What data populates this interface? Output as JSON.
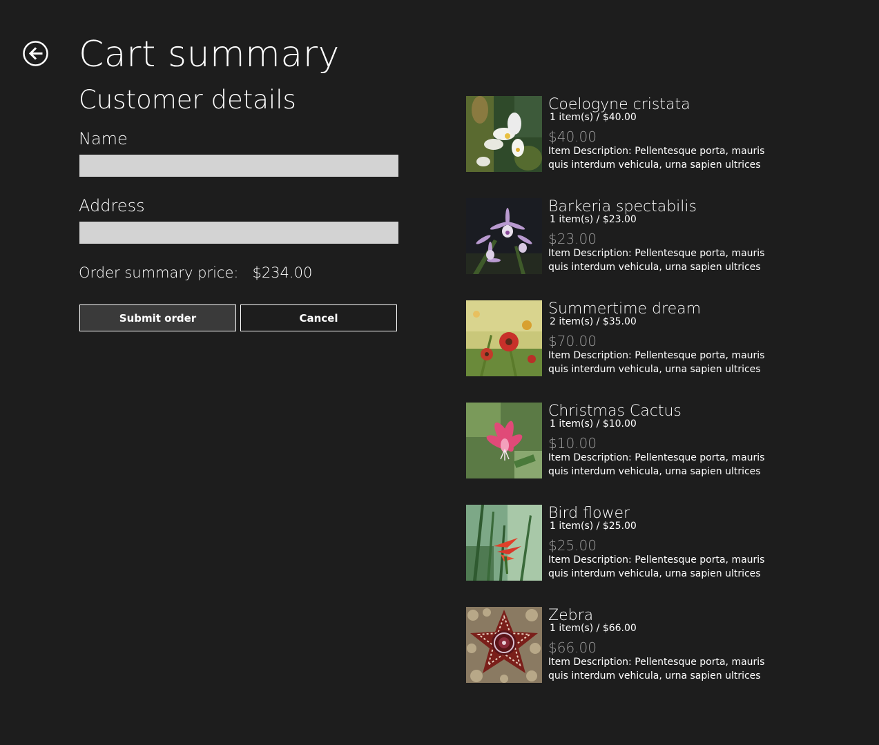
{
  "page": {
    "title": "Cart summary",
    "back_icon": "back-arrow-icon"
  },
  "customer": {
    "section_title": "Customer details",
    "name_label": "Name",
    "name_value": "",
    "address_label": "Address",
    "address_value": ""
  },
  "summary": {
    "label": "Order summary price:",
    "value": "$234.00"
  },
  "buttons": {
    "submit_label": "Submit order",
    "cancel_label": "Cancel"
  },
  "cart_items": [
    {
      "name": "Coelogyne cristata",
      "qty": "1 item(s) / $40.00",
      "total": "$40.00",
      "description": "Item Description: Pellentesque porta, mauris quis interdum vehicula, urna sapien ultrices velit, nec",
      "thumb_icon": "white-orchid-image"
    },
    {
      "name": "Barkeria spectabilis",
      "qty": "1 item(s) / $23.00",
      "total": "$23.00",
      "description": "Item Description: Pellentesque porta, mauris quis interdum vehicula, urna sapien ultrices velit, nec",
      "thumb_icon": "purple-orchid-image"
    },
    {
      "name": "Summertime dream",
      "qty": "2 item(s) / $35.00",
      "total": "$70.00",
      "description": "Item Description: Pellentesque porta, mauris quis interdum vehicula, urna sapien ultrices velit, nec",
      "thumb_icon": "red-daisy-image"
    },
    {
      "name": "Christmas Cactus",
      "qty": "1 item(s) / $10.00",
      "total": "$10.00",
      "description": "Item Description: Pellentesque porta, mauris quis interdum vehicula, urna sapien ultrices velit, nec",
      "thumb_icon": "pink-cactus-flower-image"
    },
    {
      "name": "Bird flower",
      "qty": "1 item(s) / $25.00",
      "total": "$25.00",
      "description": "Item Description: Pellentesque porta, mauris quis interdum vehicula, urna sapien ultrices velit, nec",
      "thumb_icon": "bird-of-paradise-image"
    },
    {
      "name": "Zebra",
      "qty": "1 item(s) / $66.00",
      "total": "$66.00",
      "description": "Item Description: Pellentesque porta, mauris quis interdum vehicula, urna sapien ultrices velit, nec",
      "thumb_icon": "striped-star-flower-image"
    }
  ]
}
